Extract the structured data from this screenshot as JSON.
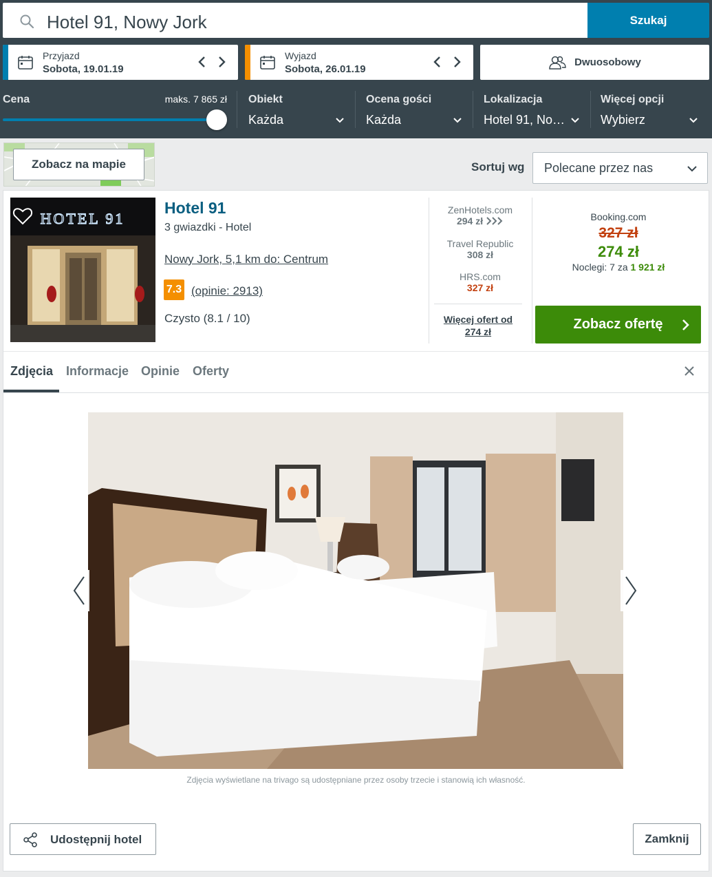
{
  "search": {
    "value": "Hotel 91, Nowy Jork",
    "button": "Szukaj"
  },
  "checkin": {
    "label": "Przyjazd",
    "value": "Sobota, 19.01.19"
  },
  "checkout": {
    "label": "Wyjazd",
    "value": "Sobota, 26.01.19"
  },
  "room": {
    "label": "Dwuosobowy"
  },
  "filters": {
    "price": {
      "title": "Cena",
      "max": "maks. 7 865 zł",
      "level": 1.0
    },
    "property": {
      "title": "Obiekt",
      "value": "Każda"
    },
    "rating": {
      "title": "Ocena gości",
      "value": "Każda"
    },
    "location": {
      "title": "Lokalizacja",
      "value": "Hotel 91, No…"
    },
    "more": {
      "title": "Więcej opcji",
      "value": "Wybierz"
    }
  },
  "map": {
    "button": "Zobacz na mapie"
  },
  "sort": {
    "label": "Sortuj wg",
    "value": "Polecane przez nas"
  },
  "hotel": {
    "name": "Hotel 91",
    "type": "3 gwiazdki -  Hotel",
    "location": "Nowy Jork, 5,1 km do: Centrum",
    "rating": "7.3",
    "reviews": "(opinie: 2913)",
    "cleanliness": "Czysto (8.1 / 10)",
    "photo_sign": "HOTEL 91"
  },
  "deals": [
    {
      "partner": "ZenHotels.com",
      "price": "294 zł"
    },
    {
      "partner": "Travel Republic",
      "price": "308 zł"
    },
    {
      "partner": "HRS.com",
      "price": "327 zł"
    }
  ],
  "more_offers": {
    "line1": "Więcej ofert od",
    "line2": "274 zł"
  },
  "main_offer": {
    "partner": "Booking.com",
    "old_price": "327 zł",
    "new_price": "274 zł",
    "nights_prefix": "Noclegi: 7 za ",
    "nights_total": "1 921 zł",
    "button": "Zobacz ofertę"
  },
  "tabs": [
    {
      "label": "Zdjęcia"
    },
    {
      "label": "Informacje"
    },
    {
      "label": "Opinie"
    },
    {
      "label": "Oferty"
    }
  ],
  "gallery": {
    "disclaimer": "Zdjęcia wyświetlane na trivago są udostępniane przez osoby trzecie i stanowią ich własność."
  },
  "footer": {
    "share": "Udostępnij hotel",
    "close": "Zamknij"
  },
  "colors": {
    "header": "#37454d",
    "search_button": "#007faf",
    "checkin_stripe": "#007faf",
    "checkout_stripe": "#f48f00",
    "offer_green": "#3c8b09",
    "price_red": "#c2400f",
    "hotel_name": "#0a5e80",
    "rating_badge": "#f48f00"
  }
}
